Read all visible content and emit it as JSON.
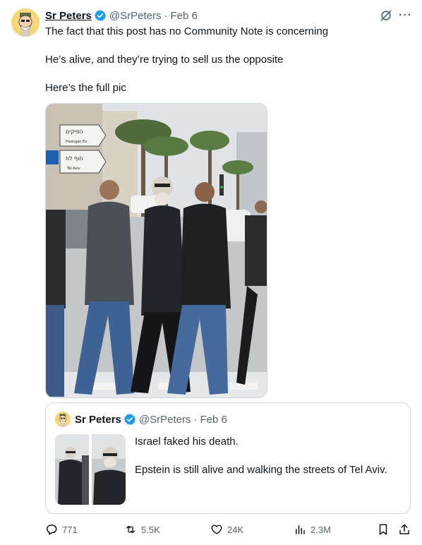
{
  "post": {
    "author_name": "Sr Peters",
    "handle": "@SrPeters",
    "separator": "·",
    "date": "Feb 6",
    "icons": [
      "verified-badge-icon",
      "grok-icon",
      "more-icon"
    ],
    "lines": [
      "The fact that this post has no Community Note is concerning",
      "He’s alive, and they’re trying to sell us the opposite",
      "Here’s the full pic"
    ],
    "media": {
      "signs": [
        "הפיקים",
        "Haangan Ex",
        "חוף לוז",
        "Tel Aviv"
      ]
    }
  },
  "quoted": {
    "author_name": "Sr Peters",
    "handle": "@SrPeters",
    "separator": "·",
    "date": "Feb 6",
    "lines": [
      "Israel faked his death.",
      "Epstein is still alive and walking the streets of Tel Aviv."
    ]
  },
  "actions": {
    "replies": "771",
    "reposts": "5.5K",
    "likes": "24K",
    "views": "2.3M",
    "icons": [
      "reply-icon",
      "repost-icon",
      "like-icon",
      "views-icon",
      "bookmark-icon",
      "share-icon"
    ]
  },
  "colors": {
    "text": "#0f1419",
    "secondary": "#536471",
    "verified": "#1d9bf0",
    "border": "#cfd9de"
  }
}
